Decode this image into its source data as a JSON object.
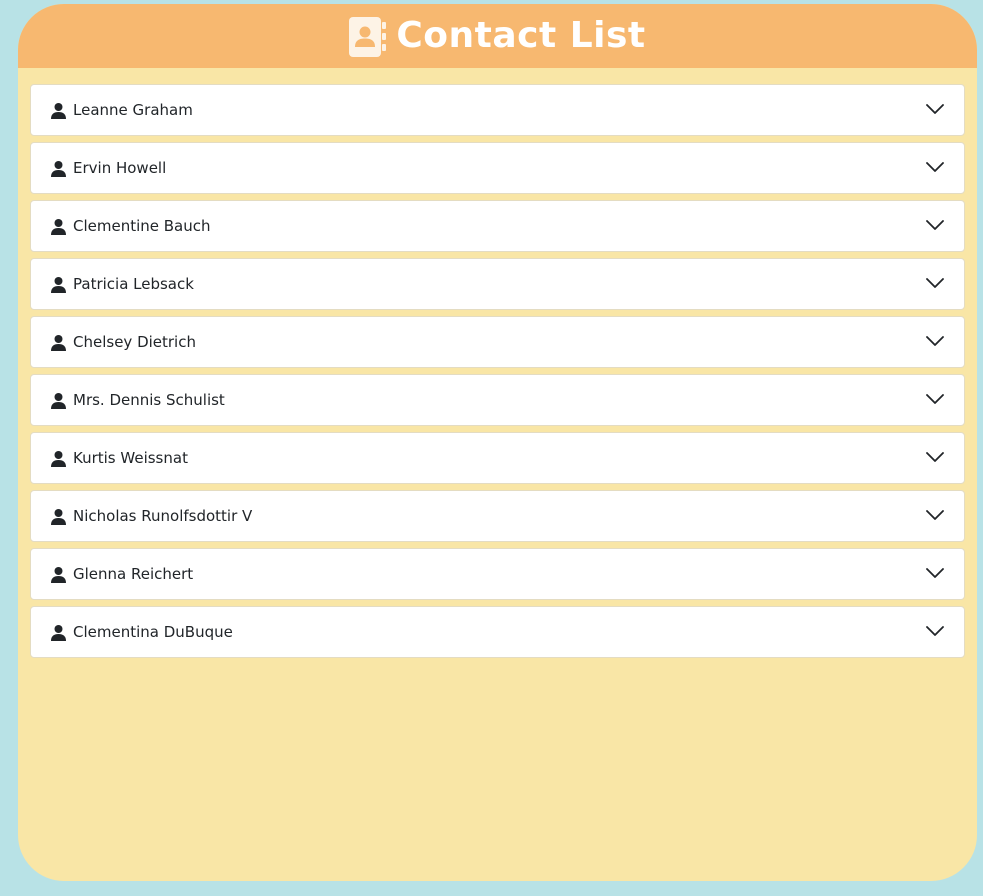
{
  "header": {
    "title": "Contact List",
    "icon": "address-book-icon"
  },
  "contacts": [
    {
      "name": "Leanne Graham"
    },
    {
      "name": "Ervin Howell"
    },
    {
      "name": "Clementine Bauch"
    },
    {
      "name": "Patricia Lebsack"
    },
    {
      "name": "Chelsey Dietrich"
    },
    {
      "name": "Mrs. Dennis Schulist"
    },
    {
      "name": "Kurtis Weissnat"
    },
    {
      "name": "Nicholas Runolfsdottir V"
    },
    {
      "name": "Glenna Reichert"
    },
    {
      "name": "Clementina DuBuque"
    }
  ],
  "icons": {
    "contact": "user-icon",
    "toggle": "chevron-down-icon"
  },
  "colors": {
    "page_background": "#b8e2e6",
    "card_background": "#f9e6a6",
    "header_background": "#f7b870",
    "title_text": "#ffffff",
    "item_background": "#ffffff",
    "item_text": "#212529"
  }
}
